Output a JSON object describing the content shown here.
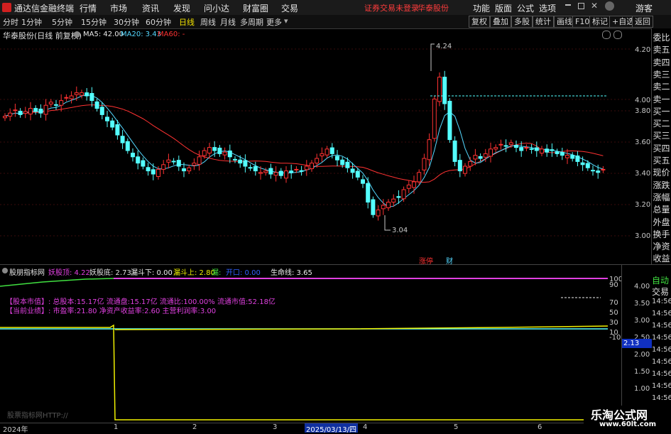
{
  "app": {
    "title": "通达信金融终端",
    "menu": [
      "行情",
      "市场",
      "资讯",
      "发现",
      "问小达",
      "财富圈",
      "交易"
    ],
    "notice": [
      "证券交易未登录",
      "华泰股份"
    ],
    "right_menu": [
      "功能",
      "版面",
      "公式",
      "选项"
    ],
    "guest": "游客"
  },
  "toolbar": {
    "periods": [
      "分时",
      "1分钟",
      "5分钟",
      "15分钟",
      "30分钟",
      "60分钟",
      "日线",
      "周线",
      "月线",
      "多周期",
      "更多"
    ],
    "active_period": "日线",
    "right_buttons": [
      "复权",
      "叠加",
      "多股",
      "统计",
      "画线",
      "F10",
      "标记",
      "+自选",
      "返回"
    ]
  },
  "chart": {
    "stock_title": "华泰股份(日线 前复权)",
    "ma5": "MA5: 42.00",
    "ma20": "MA20: 3.43",
    "ma60": "MA60: -",
    "y_labels": [
      "4.20",
      "4.00",
      "3.80",
      "3.60",
      "3.40",
      "3.20",
      "3.00"
    ],
    "high_label": "4.24",
    "low_label": "3.04",
    "event_labels": [
      "涨停",
      "财"
    ]
  },
  "order_panel": {
    "items": [
      "委比",
      "卖五",
      "卖四",
      "卖三",
      "卖二",
      "卖一",
      "买一",
      "买二",
      "买三",
      "买四",
      "买五",
      "现价",
      "涨跌",
      "涨幅",
      "总量",
      "外盘",
      "换手",
      "净资",
      "收益"
    ]
  },
  "indicator": {
    "name": "股朋指标网",
    "values": [
      {
        "text": "妖股顶: 4.22",
        "color": "#e040e0"
      },
      {
        "text": "妖股底: 2.73",
        "color": "#e0e0e0"
      },
      {
        "text": "漏斗下: 0.00",
        "color": "#f0f0f0"
      },
      {
        "text": "漏斗上: 2.80",
        "color": "#f0f000"
      },
      {
        "text": "漏: ",
        "color": "#40e040"
      },
      {
        "text": "开口: 0.00",
        "color": "#3060ff"
      },
      {
        "text": "生命线: 3.65",
        "color": "#f0f0f0"
      }
    ],
    "y_labels": [
      "100",
      "90",
      "70",
      "50",
      "30",
      "10",
      "-10"
    ],
    "info_line1": "【股本市值】: 总股本:15.17亿 流通盘:15.17亿 流通比:100.00% 流通市值:52.18亿",
    "info_line2": "【当前业绩】: 市盈率:21.80 净资产收益率:2.60 主营利润率:3.00",
    "watermark": "股票指标网HTTP://"
  },
  "date_axis": {
    "left_label": "2024年",
    "ticks": [
      "1",
      "2",
      "3",
      "2025/03/13/四",
      "4",
      "5",
      "6"
    ]
  },
  "trade_panel": {
    "header": "自动",
    "title": "交易",
    "prices": [
      "4.00",
      "3.50",
      "3.00",
      "2.50",
      "2.00",
      "1.50",
      "1.00"
    ],
    "times": [
      "14:56",
      "14:56",
      "14:56",
      "14:56",
      "14:56",
      "14:56",
      "14:56",
      "14:56",
      "14:56"
    ],
    "current_price": "2.13"
  },
  "site_badge": {
    "name": "乐淘公式网",
    "url": "www.60lt.com"
  },
  "colors": {
    "up": "#ff3232",
    "down": "#54ffff",
    "ma5": "#ffffff",
    "ma20": "#54d8ff",
    "ma60": "#ff3232",
    "grid": "#3a0c0c"
  }
}
